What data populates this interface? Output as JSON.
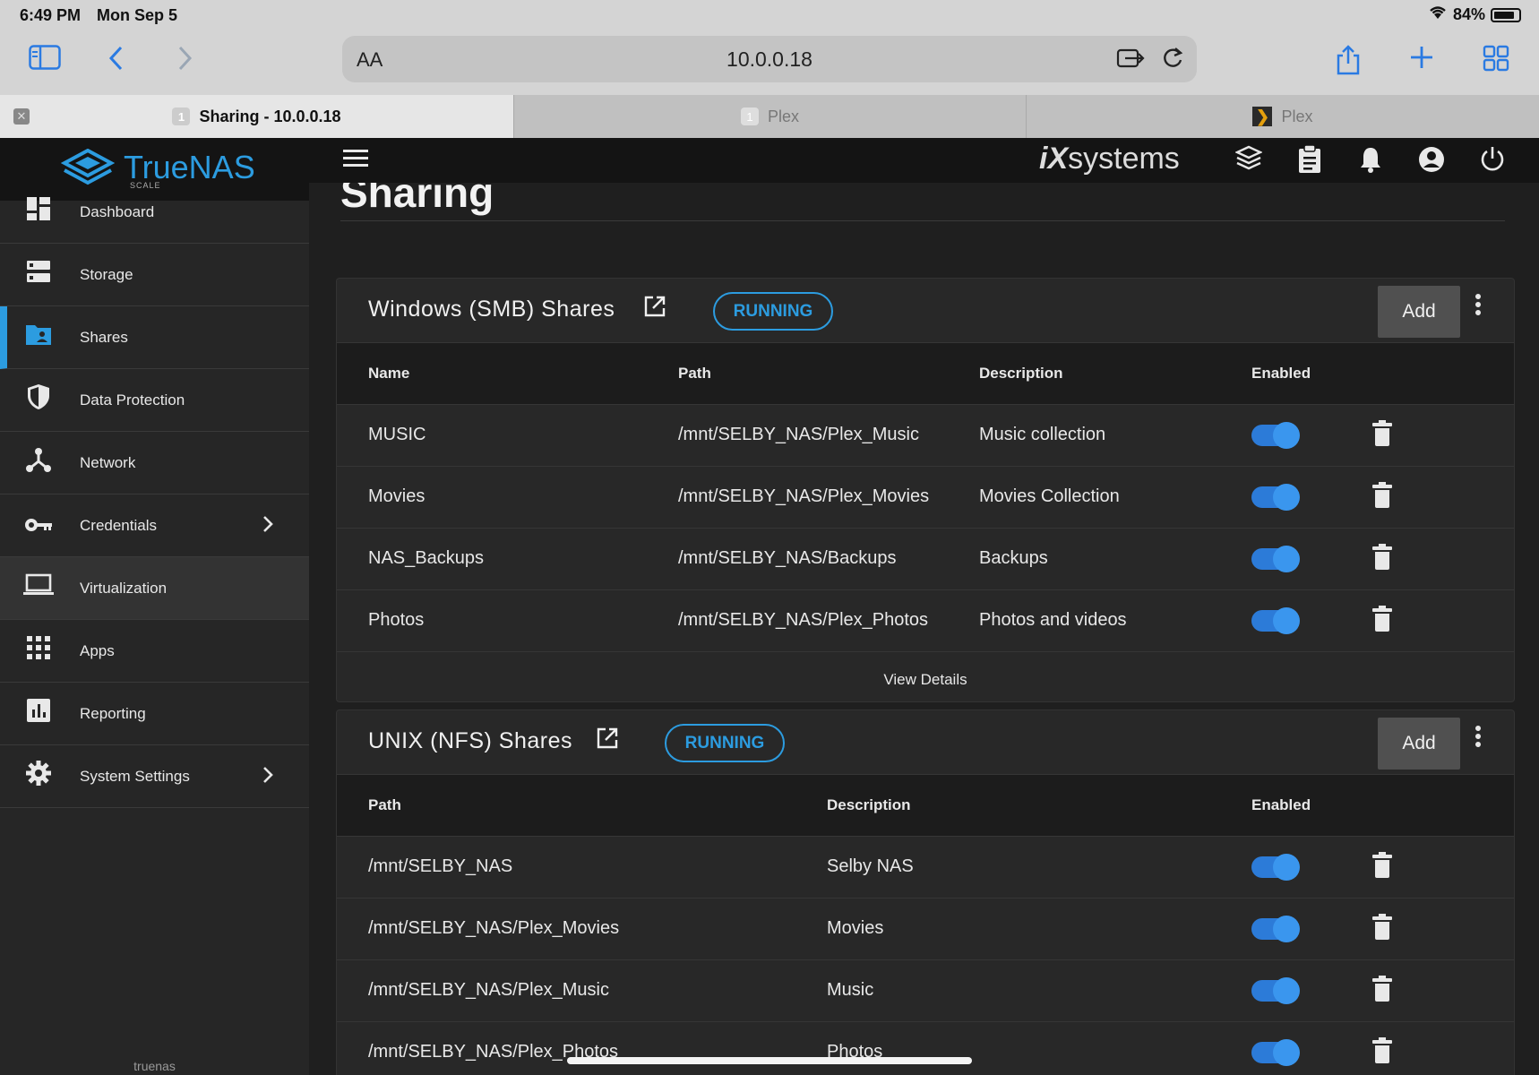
{
  "status_bar": {
    "time": "6:49 PM",
    "date": "Mon Sep 5",
    "battery": "84%"
  },
  "browser": {
    "url_aa": "AA",
    "url": "10.0.0.18",
    "tabs": [
      {
        "badge": "1",
        "title": "Sharing - 10.0.0.18",
        "active": true
      },
      {
        "badge": "1",
        "title": "Plex",
        "active": false
      },
      {
        "badge": "❯",
        "title": "Plex",
        "active": false
      }
    ]
  },
  "brand": {
    "logo": "TrueNAS",
    "edition": "SCALE",
    "vendor": "iXsystems"
  },
  "sidebar": {
    "items": [
      {
        "label": "Dashboard",
        "icon": "dashboard-icon"
      },
      {
        "label": "Storage",
        "icon": "storage-icon"
      },
      {
        "label": "Shares",
        "icon": "folder-shared-icon"
      },
      {
        "label": "Data Protection",
        "icon": "shield-icon"
      },
      {
        "label": "Network",
        "icon": "network-icon"
      },
      {
        "label": "Credentials",
        "icon": "key-icon"
      },
      {
        "label": "Virtualization",
        "icon": "laptop-icon"
      },
      {
        "label": "Apps",
        "icon": "apps-grid-icon"
      },
      {
        "label": "Reporting",
        "icon": "bar-chart-icon"
      },
      {
        "label": "System Settings",
        "icon": "gear-icon"
      }
    ],
    "hostname": "truenas"
  },
  "page": {
    "title": "Sharing"
  },
  "smb": {
    "title": "Windows (SMB) Shares",
    "status": "RUNNING",
    "add_label": "Add",
    "columns": [
      "Name",
      "Path",
      "Description",
      "Enabled"
    ],
    "rows": [
      {
        "name": "MUSIC",
        "path": "/mnt/SELBY_NAS/Plex_Music",
        "description": "Music collection",
        "enabled": true
      },
      {
        "name": "Movies",
        "path": "/mnt/SELBY_NAS/Plex_Movies",
        "description": "Movies Collection",
        "enabled": true
      },
      {
        "name": "NAS_Backups",
        "path": "/mnt/SELBY_NAS/Backups",
        "description": "Backups",
        "enabled": true
      },
      {
        "name": "Photos",
        "path": "/mnt/SELBY_NAS/Plex_Photos",
        "description": "Photos and videos",
        "enabled": true
      }
    ],
    "view_details": "View Details"
  },
  "nfs": {
    "title": "UNIX (NFS) Shares",
    "status": "RUNNING",
    "add_label": "Add",
    "columns": [
      "Path",
      "Description",
      "Enabled"
    ],
    "rows": [
      {
        "path": "/mnt/SELBY_NAS",
        "description": "Selby NAS",
        "enabled": true
      },
      {
        "path": "/mnt/SELBY_NAS/Plex_Movies",
        "description": "Movies",
        "enabled": true
      },
      {
        "path": "/mnt/SELBY_NAS/Plex_Music",
        "description": "Music",
        "enabled": true
      },
      {
        "path": "/mnt/SELBY_NAS/Plex_Photos",
        "description": "Photos",
        "enabled": true
      }
    ]
  },
  "colors": {
    "accent": "#2c9ce0",
    "toggle": "#2c7bd8",
    "background": "#1f1f1f",
    "card": "#282828"
  }
}
